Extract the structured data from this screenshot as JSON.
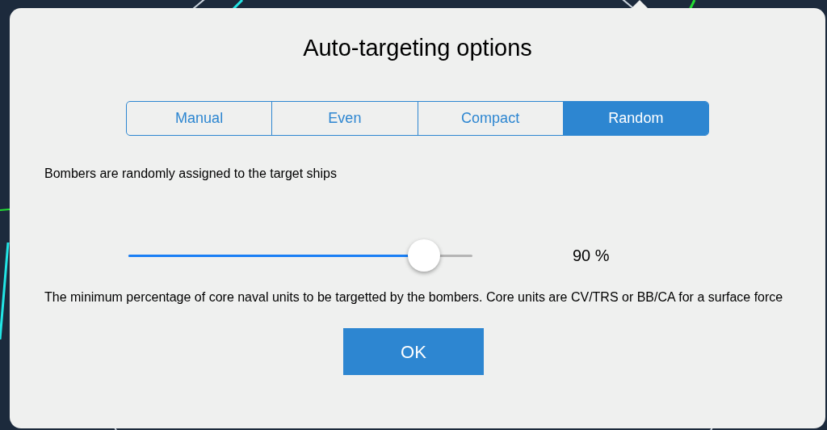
{
  "dialog": {
    "title": "Auto-targeting options",
    "modes": [
      {
        "label": "Manual",
        "selected": false
      },
      {
        "label": "Even",
        "selected": false
      },
      {
        "label": "Compact",
        "selected": false
      },
      {
        "label": "Random",
        "selected": true
      }
    ],
    "mode_description": "Bombers are randomly assigned to the target ships",
    "slider": {
      "level": 0.86,
      "reading": "90 %"
    },
    "slider_description": "The minimum percentage of core naval units to be targetted by the bombers. Core units are CV/TRS or BB/CA for a surface force",
    "buttons": [
      "OK"
    ]
  }
}
